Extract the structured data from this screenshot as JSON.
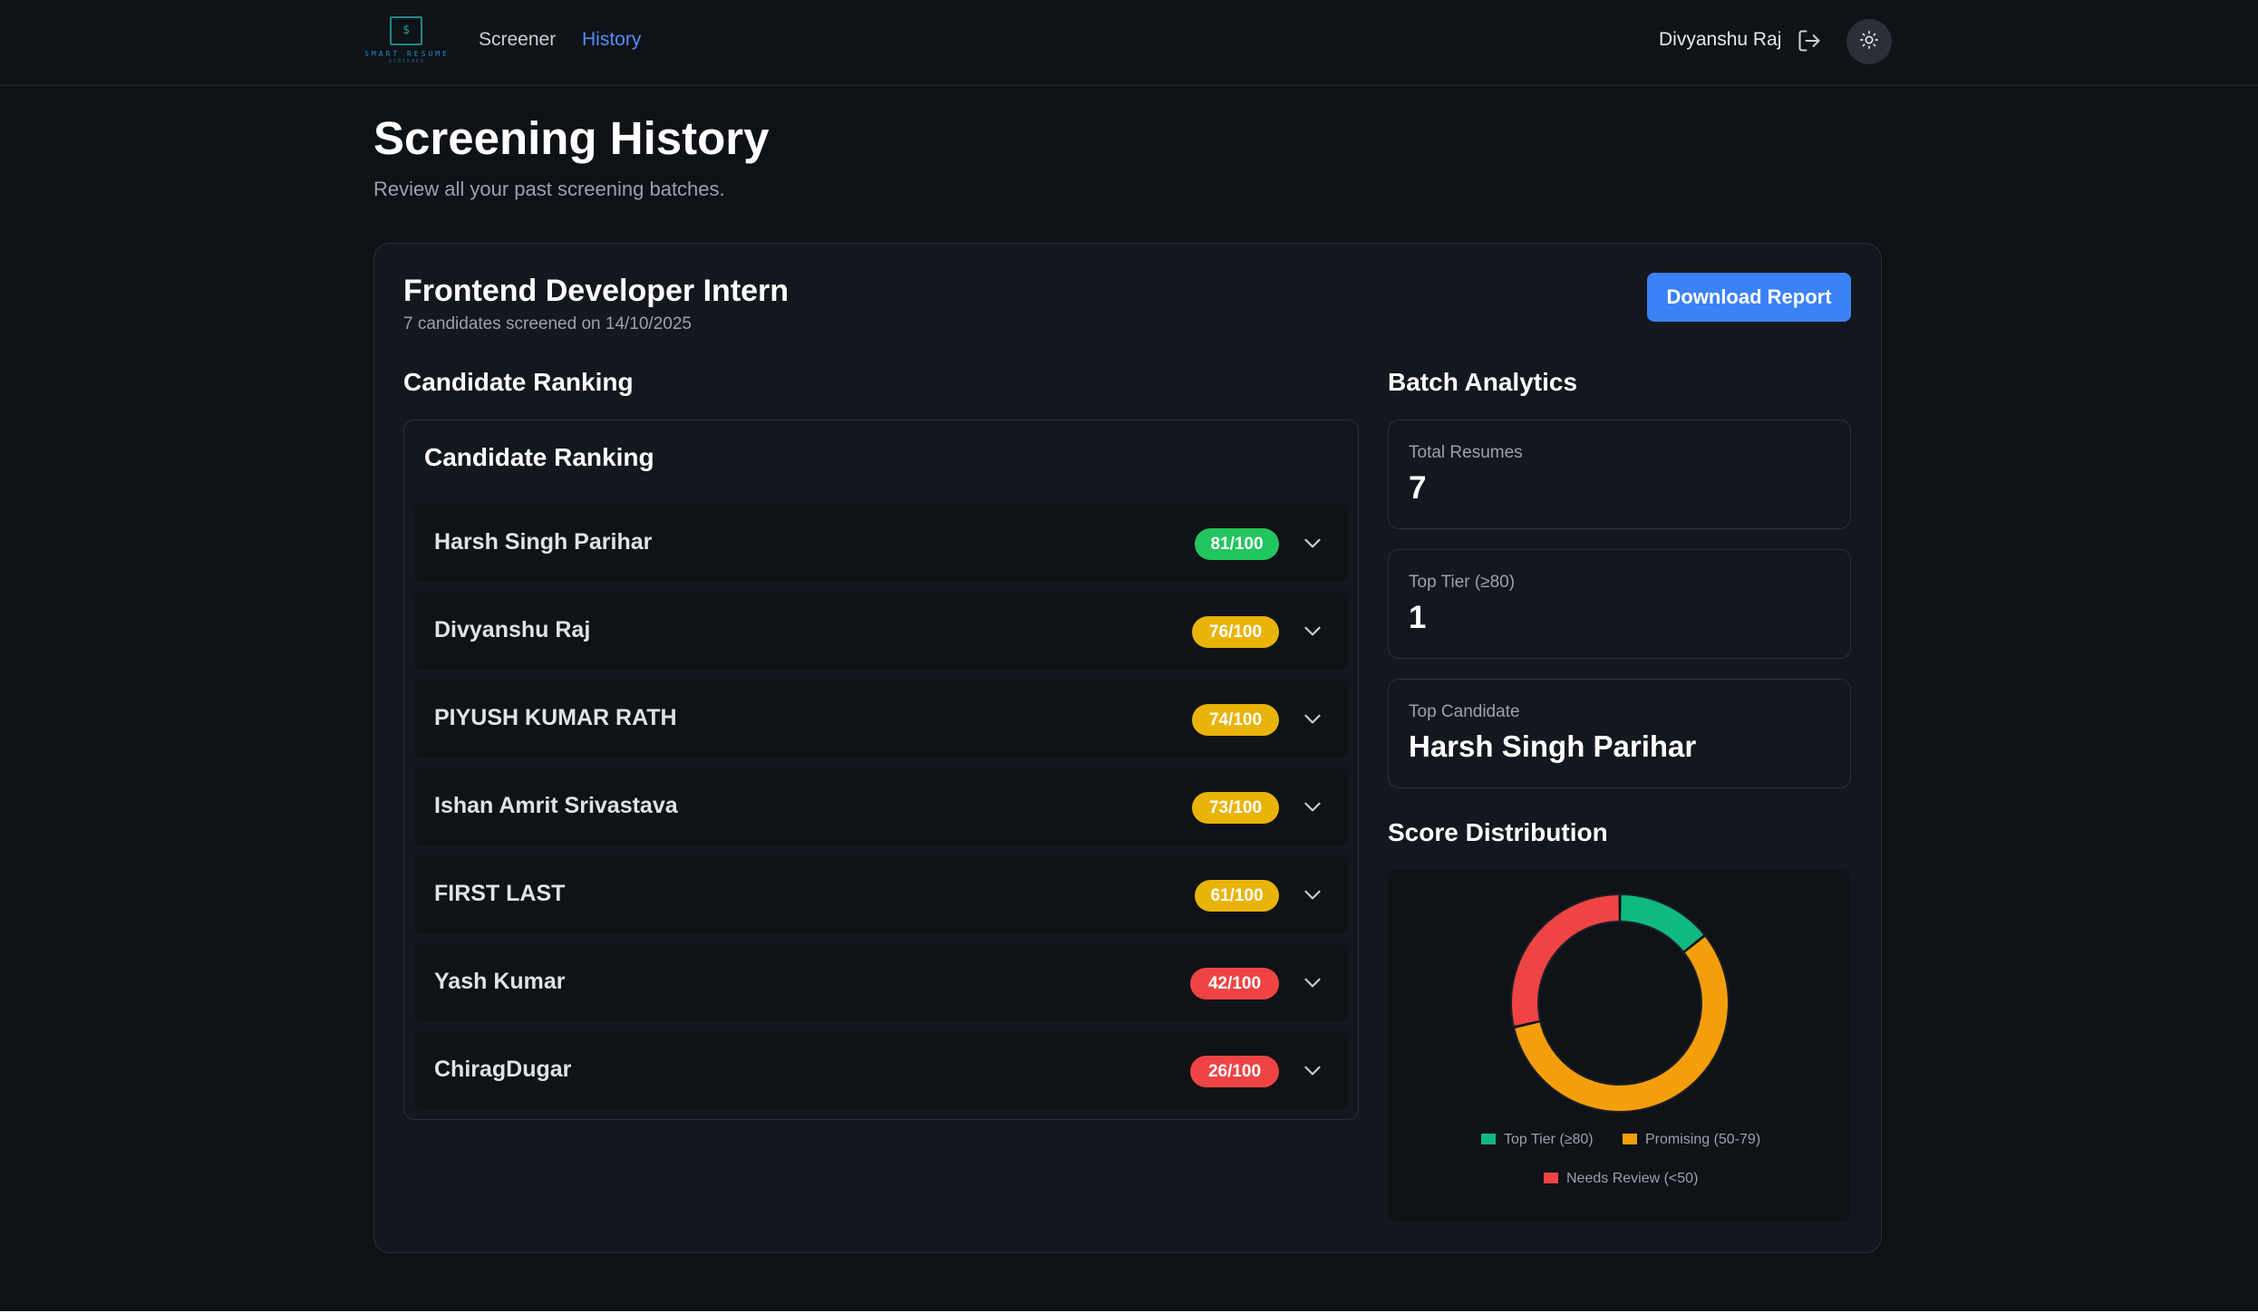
{
  "brand": {
    "logo_glyph": "$",
    "logo_text": "SMART RESUME",
    "logo_sub": "SCREENER"
  },
  "nav": {
    "links": [
      {
        "label": "Screener",
        "active": false
      },
      {
        "label": "History",
        "active": true
      }
    ],
    "user_name": "Divyanshu Raj",
    "logout_icon": "logout-icon",
    "theme_icon": "sun-icon"
  },
  "header": {
    "title": "Screening History",
    "subtitle": "Review all your past screening batches."
  },
  "batch": {
    "title": "Frontend Developer Intern",
    "subtitle": "7 candidates screened on 14/10/2025",
    "download_label": "Download Report"
  },
  "ranking": {
    "section_title": "Candidate Ranking",
    "inner_title": "Candidate Ranking",
    "candidates": [
      {
        "name": "Harsh Singh Parihar",
        "score": "81/100",
        "tier": "green"
      },
      {
        "name": "Divyanshu Raj",
        "score": "76/100",
        "tier": "yellow"
      },
      {
        "name": "PIYUSH KUMAR RATH",
        "score": "74/100",
        "tier": "yellow"
      },
      {
        "name": "Ishan Amrit Srivastava",
        "score": "73/100",
        "tier": "yellow"
      },
      {
        "name": "FIRST LAST",
        "score": "61/100",
        "tier": "yellow"
      },
      {
        "name": "Yash Kumar",
        "score": "42/100",
        "tier": "red"
      },
      {
        "name": "ChiragDugar",
        "score": "26/100",
        "tier": "red"
      }
    ]
  },
  "analytics": {
    "section_title": "Batch Analytics",
    "stats": [
      {
        "label": "Total Resumes",
        "value": "7"
      },
      {
        "label": "Top Tier (≥80)",
        "value": "1"
      },
      {
        "label": "Top Candidate",
        "value": "Harsh Singh Parihar"
      }
    ],
    "distribution_title": "Score Distribution"
  },
  "colors": {
    "accent": "#3b82f6",
    "top_tier": "#10b981",
    "promising": "#f59e0b",
    "needs_review": "#ef4444"
  },
  "chart_data": {
    "type": "pie",
    "donut": true,
    "categories": [
      "Top Tier (≥80)",
      "Promising (50-79)",
      "Needs Review (<50)"
    ],
    "values": [
      1,
      4,
      2
    ],
    "colors": [
      "#10b981",
      "#f59e0b",
      "#ef4444"
    ],
    "legend": "bottom"
  }
}
